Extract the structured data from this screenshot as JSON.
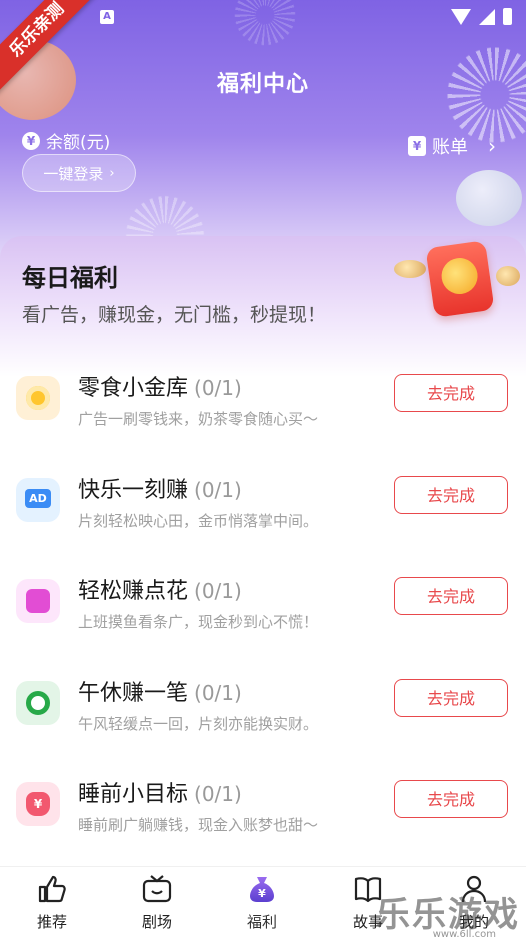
{
  "badge": "乐乐亲测",
  "status": {
    "app_icon": "A"
  },
  "header": {
    "title": "福利中心",
    "balance_label": "余额(元)",
    "yen_symbol": "¥",
    "login_label": "一键登录",
    "login_chevron": "›",
    "bill_label": "账单",
    "bill_chevron": "›"
  },
  "daily": {
    "title": "每日福利",
    "subtitle": "看广告，赚现金，无门槛，秒提现！"
  },
  "tasks": [
    {
      "title": "零食小金库",
      "count": "(0/1)",
      "desc": "广告一刷零钱来，奶茶零食随心买～",
      "button": "去完成",
      "icon": "gold-coin-icon"
    },
    {
      "title": "快乐一刻赚",
      "count": "(0/1)",
      "desc": "片刻轻松映心田，金币悄落掌中间。",
      "button": "去完成",
      "icon": "ad-screen-icon",
      "icon_text": "AD"
    },
    {
      "title": "轻松赚点花",
      "count": "(0/1)",
      "desc": "上班摸鱼看条广，现金秒到心不慌！",
      "button": "去完成",
      "icon": "coin-stack-icon"
    },
    {
      "title": "午休赚一笔",
      "count": "(0/1)",
      "desc": "午风轻缓点一回，片刻亦能换实财。",
      "button": "去完成",
      "icon": "green-ring-icon"
    },
    {
      "title": "睡前小目标",
      "count": "(0/1)",
      "desc": "睡前刷广躺赚钱，现金入账梦也甜～",
      "button": "去完成",
      "icon": "money-bag-icon"
    }
  ],
  "tabs": [
    {
      "label": "推荐",
      "icon": "thumbs-up-icon"
    },
    {
      "label": "剧场",
      "icon": "tv-icon"
    },
    {
      "label": "福利",
      "icon": "money-bag-icon",
      "active": true
    },
    {
      "label": "故事",
      "icon": "book-icon"
    },
    {
      "label": "我的",
      "icon": "user-icon"
    }
  ],
  "watermark": {
    "text": "乐乐游戏",
    "url": "www.6ll.com"
  },
  "colors": {
    "accent": "#e8494c",
    "header": "#8b70e6"
  }
}
